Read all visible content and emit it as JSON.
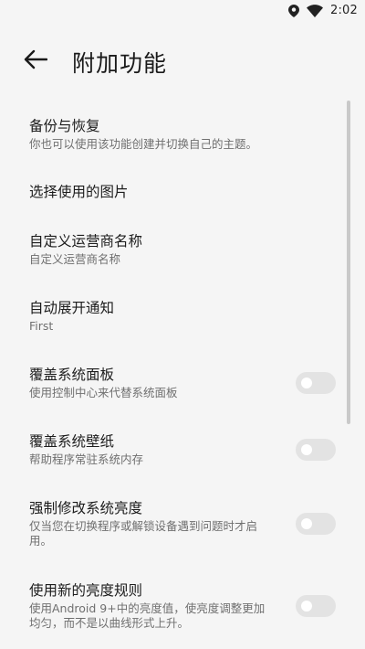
{
  "status": {
    "time": "2:02",
    "icons": [
      "location-icon",
      "wifi-icon"
    ]
  },
  "toolbar": {
    "title": "附加功能",
    "back_icon": "arrow-left-icon"
  },
  "items": [
    {
      "title": "备份与恢复",
      "summary": "你也可以使用该功能创建并切换自己的主题。",
      "has_toggle": false
    },
    {
      "title": "选择使用的图片",
      "summary": "",
      "has_toggle": false
    },
    {
      "title": "自定义运营商名称",
      "summary": "自定义运营商名称",
      "has_toggle": false
    },
    {
      "title": "自动展开通知",
      "summary": "First",
      "has_toggle": false
    },
    {
      "title": "覆盖系统面板",
      "summary": "使用控制中心来代替系统面板",
      "has_toggle": true,
      "toggle_on": false
    },
    {
      "title": "覆盖系统壁纸",
      "summary": "帮助程序常驻系统内存",
      "has_toggle": true,
      "toggle_on": false
    },
    {
      "title": "强制修改系统亮度",
      "summary": "仅当您在切换程序或解锁设备遇到问题时才启用。",
      "has_toggle": true,
      "toggle_on": false
    },
    {
      "title": "使用新的亮度规则",
      "summary": "使用Android 9+中的亮度值，使亮度调整更加均匀，而不是以曲线形式上升。",
      "has_toggle": true,
      "toggle_on": false
    }
  ],
  "colors": {
    "background": "#f5f5f5",
    "toggle_off_track": "#e3e3e3",
    "scrollbar": "#c9c9c9"
  }
}
